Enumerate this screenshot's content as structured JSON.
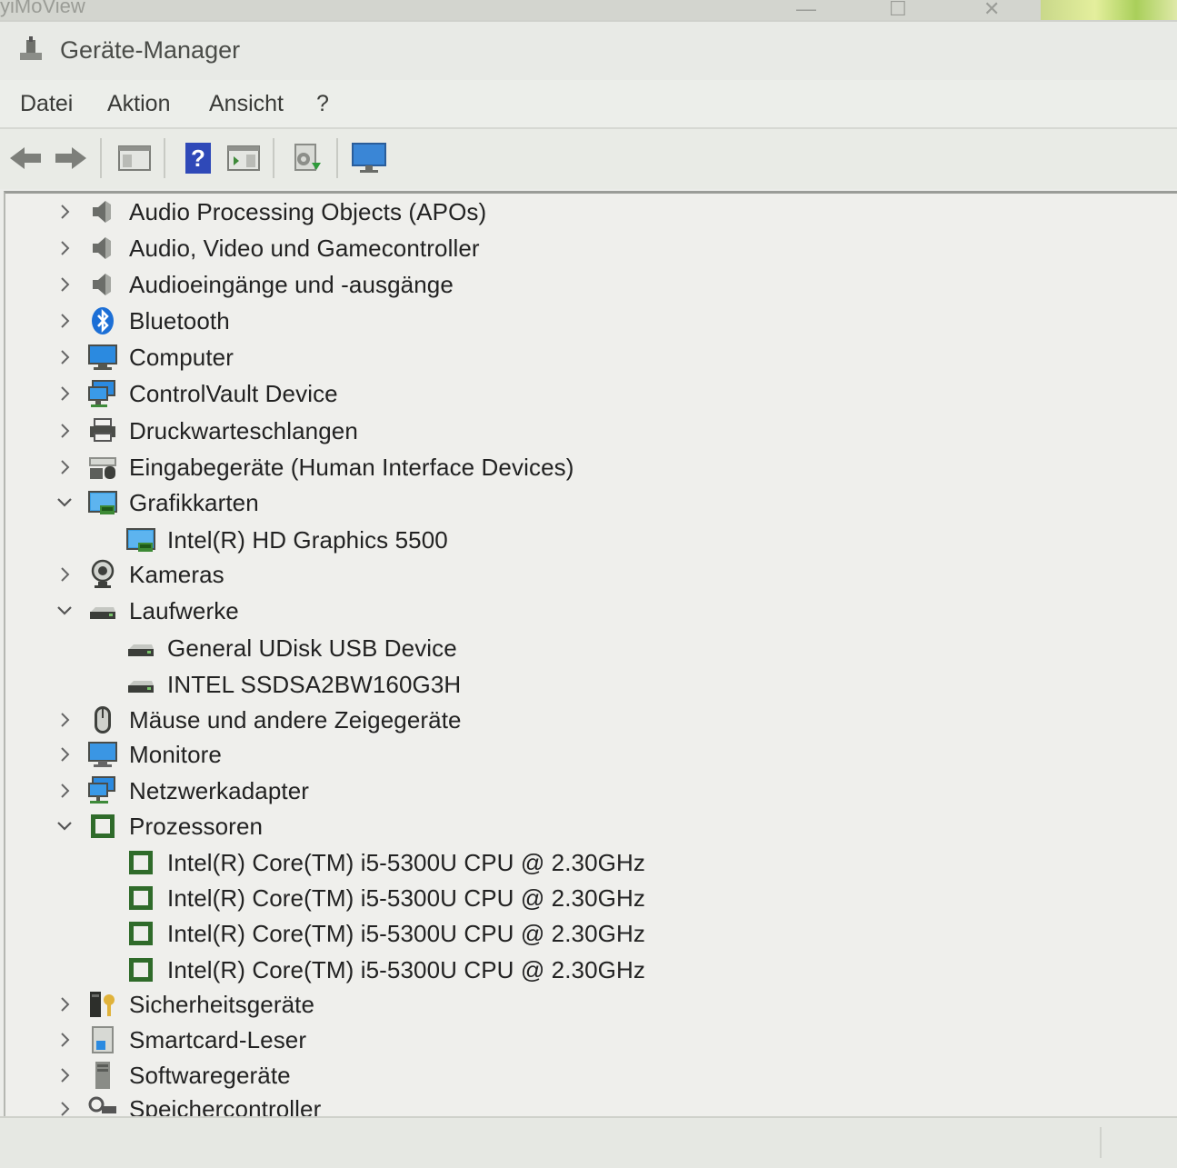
{
  "window": {
    "title": "Geräte-Manager"
  },
  "background_app": {
    "ghost_title": "yiMoView"
  },
  "menu": [
    "Datei",
    "Aktion",
    "Ansicht",
    "?"
  ],
  "toolbar": [
    {
      "name": "back-button",
      "icon": "arrow-left-icon"
    },
    {
      "name": "forward-button",
      "icon": "arrow-right-icon"
    },
    {
      "name": "show-hide-console-tree-button",
      "icon": "console-tree-icon"
    },
    {
      "name": "help-button",
      "icon": "help-icon"
    },
    {
      "name": "action-pane-button",
      "icon": "action-pane-icon"
    },
    {
      "name": "update-driver-button",
      "icon": "update-driver-icon"
    },
    {
      "name": "scan-hardware-button",
      "icon": "monitor-scan-icon"
    }
  ],
  "tree": [
    {
      "label": "Audio Processing Objects (APOs)",
      "icon": "speaker-icon",
      "expanded": false,
      "level": 0
    },
    {
      "label": "Audio, Video und Gamecontroller",
      "icon": "speaker-icon",
      "expanded": false,
      "level": 0
    },
    {
      "label": "Audioeingänge und -ausgänge",
      "icon": "speaker-icon",
      "expanded": false,
      "level": 0
    },
    {
      "label": "Bluetooth",
      "icon": "bluetooth-icon",
      "expanded": false,
      "level": 0
    },
    {
      "label": "Computer",
      "icon": "computer-icon",
      "expanded": false,
      "level": 0
    },
    {
      "label": "ControlVault Device",
      "icon": "network-computer-icon",
      "expanded": false,
      "level": 0
    },
    {
      "label": "Druckwarteschlangen",
      "icon": "printer-icon",
      "expanded": false,
      "level": 0
    },
    {
      "label": "Eingabegeräte (Human Interface Devices)",
      "icon": "hid-icon",
      "expanded": false,
      "level": 0
    },
    {
      "label": "Grafikkarten",
      "icon": "display-adapter-icon",
      "expanded": true,
      "level": 0
    },
    {
      "label": "Intel(R) HD Graphics 5500",
      "icon": "display-adapter-icon",
      "level": 1
    },
    {
      "label": "Kameras",
      "icon": "camera-icon",
      "expanded": false,
      "level": 0
    },
    {
      "label": "Laufwerke",
      "icon": "drive-icon",
      "expanded": true,
      "level": 0
    },
    {
      "label": "General UDisk USB Device",
      "icon": "drive-icon",
      "level": 1
    },
    {
      "label": "INTEL SSDSA2BW160G3H",
      "icon": "drive-icon",
      "level": 1
    },
    {
      "label": "Mäuse und andere Zeigegeräte",
      "icon": "mouse-icon",
      "expanded": false,
      "level": 0
    },
    {
      "label": "Monitore",
      "icon": "monitor-icon",
      "expanded": false,
      "level": 0
    },
    {
      "label": "Netzwerkadapter",
      "icon": "network-adapter-icon",
      "expanded": false,
      "level": 0
    },
    {
      "label": "Prozessoren",
      "icon": "processor-icon",
      "expanded": true,
      "level": 0
    },
    {
      "label": "Intel(R) Core(TM) i5-5300U CPU @ 2.30GHz",
      "icon": "processor-icon",
      "level": 1
    },
    {
      "label": "Intel(R) Core(TM) i5-5300U CPU @ 2.30GHz",
      "icon": "processor-icon",
      "level": 1
    },
    {
      "label": "Intel(R) Core(TM) i5-5300U CPU @ 2.30GHz",
      "icon": "processor-icon",
      "level": 1
    },
    {
      "label": "Intel(R) Core(TM) i5-5300U CPU @ 2.30GHz",
      "icon": "processor-icon",
      "level": 1
    },
    {
      "label": "Sicherheitsgeräte",
      "icon": "security-device-icon",
      "expanded": false,
      "level": 0
    },
    {
      "label": "Smartcard-Leser",
      "icon": "smartcard-reader-icon",
      "expanded": false,
      "level": 0
    },
    {
      "label": "Softwaregeräte",
      "icon": "software-device-icon",
      "expanded": false,
      "level": 0
    },
    {
      "label": "Speichercontroller",
      "icon": "storage-controller-icon",
      "expanded": false,
      "level": 0
    }
  ],
  "colors": {
    "accent_blue": "#1c6fd6",
    "processor_green": "#2f6b2a",
    "window_bg": "#ecedea"
  }
}
